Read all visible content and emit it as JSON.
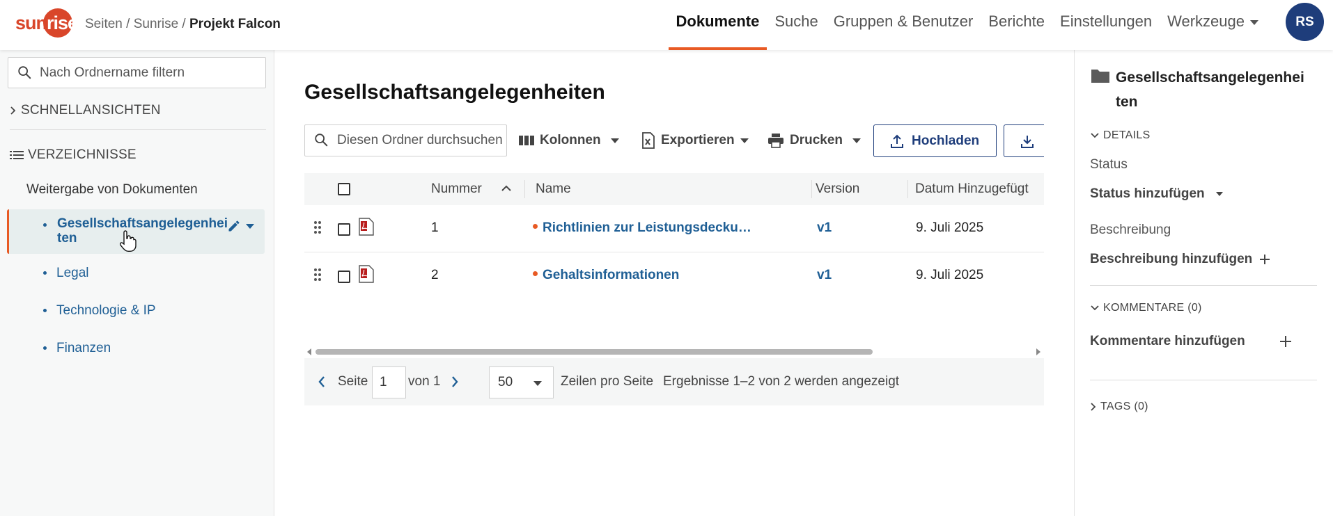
{
  "header": {
    "logo_text_a": "sun",
    "logo_text_b": "rise",
    "breadcrumb": [
      "Seiten",
      "Sunrise",
      "Projekt Falcon"
    ],
    "breadcrumb_sep": " / ",
    "nav": [
      "Dokumente",
      "Suche",
      "Gruppen & Benutzer",
      "Berichte",
      "Einstellungen",
      "Werkzeuge"
    ],
    "active_nav": "Dokumente",
    "avatar_initials": "RS"
  },
  "sidebar": {
    "filter_placeholder": "Nach Ordnername filtern",
    "quick_views": "SCHNELLANSICHTEN",
    "directories": "VERZEICHNISSE",
    "root": "Weitergabe von Dokumenten",
    "folders": [
      {
        "label": "Gesellschaftsangelegenheiten",
        "line1": "Gesellschaftsangelegenhei",
        "line2": "ten",
        "active": true
      },
      {
        "label": "Legal"
      },
      {
        "label": "Technologie & IP"
      },
      {
        "label": "Finanzen"
      }
    ]
  },
  "main": {
    "title": "Gesellschaftsangelegenheiten",
    "search_placeholder": "Diesen Ordner durchsuchen",
    "toolbar": {
      "columns": "Kolonnen",
      "export": "Exportieren",
      "print": "Drucken",
      "upload": "Hochladen"
    },
    "table": {
      "columns": [
        "Nummer",
        "Name",
        "Version",
        "Datum Hinzugefügt"
      ],
      "rows": [
        {
          "number": "1",
          "name": "Richtlinien zur Leistungsdecku…",
          "version": "v1",
          "date": "9. Juli 2025"
        },
        {
          "number": "2",
          "name": "Gehaltsinformationen",
          "version": "v1",
          "date": "9. Juli 2025"
        }
      ]
    },
    "pager": {
      "page_label": "Seite",
      "page_value": "1",
      "of_label": "von 1",
      "rows_value": "50",
      "rows_label": "Zeilen pro Seite",
      "results": "Ergebnisse 1–2 von 2 werden angezeigt"
    }
  },
  "rpanel": {
    "title_line1": "Gesellschaftsangelegenhei",
    "title_line2": "ten",
    "details": "DETAILS",
    "status_label": "Status",
    "status_action": "Status hinzufügen",
    "desc_label": "Beschreibung",
    "desc_action": "Beschreibung hinzufügen",
    "comments": "KOMMENTARE (0)",
    "comments_action": "Kommentare hinzufügen",
    "tags": "TAGS (0)"
  },
  "colors": {
    "brand_orange": "#e85a24",
    "brand_red": "#d9462a",
    "navy": "#1e3d7b",
    "link_blue": "#1f5f95"
  }
}
